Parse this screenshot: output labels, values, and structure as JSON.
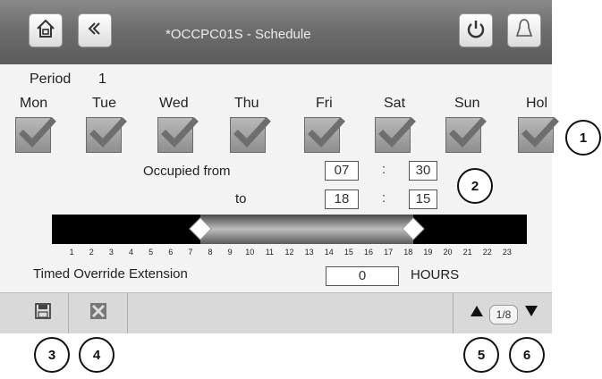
{
  "header": {
    "title": "*OCCPC01S - Schedule",
    "home_icon": "home-icon",
    "back_icon": "back-icon",
    "power_icon": "power-icon",
    "bell_icon": "bell-icon"
  },
  "period": {
    "label": "Period",
    "value": "1"
  },
  "days": [
    {
      "label": "Mon",
      "checked": true
    },
    {
      "label": "Tue",
      "checked": true
    },
    {
      "label": "Wed",
      "checked": true
    },
    {
      "label": "Thu",
      "checked": true
    },
    {
      "label": "Fri",
      "checked": true
    },
    {
      "label": "Sat",
      "checked": true
    },
    {
      "label": "Sun",
      "checked": true
    },
    {
      "label": "Hol",
      "checked": true
    }
  ],
  "occupied": {
    "from_label": "Occupied from",
    "to_label": "to",
    "separator": ":",
    "from_hour": "07",
    "from_minute": "30",
    "to_hour": "18",
    "to_minute": "15"
  },
  "timeline": {
    "start_hour": 7.5,
    "end_hour": 18.25,
    "ticks": [
      "1",
      "2",
      "3",
      "4",
      "5",
      "6",
      "7",
      "8",
      "9",
      "10",
      "11",
      "12",
      "13",
      "14",
      "15",
      "16",
      "17",
      "18",
      "19",
      "20",
      "21",
      "22",
      "23"
    ]
  },
  "override": {
    "label": "Timed Override Extension",
    "value": "0",
    "unit": "HOURS"
  },
  "footer": {
    "save_icon": "save-icon",
    "cancel_icon": "cancel-icon",
    "page": "1/8"
  },
  "callouts": [
    "1",
    "2",
    "3",
    "4",
    "5",
    "6"
  ],
  "colors": {
    "header": "#6d6d6d",
    "screen": "#f3f3f3",
    "bar": "#000000",
    "check": "#7a7a7a"
  }
}
